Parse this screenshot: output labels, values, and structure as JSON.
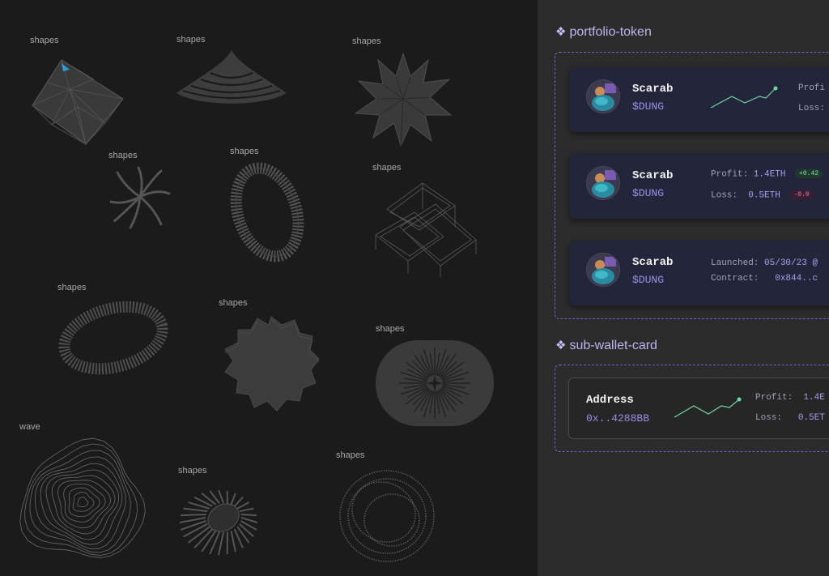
{
  "asset_panel": {
    "labels": [
      "shapes",
      "shapes",
      "shapes",
      "shapes",
      "shapes",
      "shapes",
      "shapes",
      "shapes",
      "shapes",
      "wave",
      "shapes",
      "shapes"
    ]
  },
  "colors": {
    "accent": "#7d5bd6",
    "spark": "#6fd6a0",
    "ticker": "#9a8fe8",
    "card_bg": "#23263a"
  },
  "components": {
    "portfolio_token": {
      "title": "portfolio-token",
      "icon": "component-diamond-icon",
      "cards": [
        {
          "name": "Scarab",
          "ticker": "$DUNG",
          "line1_label": "Profi",
          "line2_label": "Loss:"
        },
        {
          "name": "Scarab",
          "ticker": "$DUNG",
          "profit_label": "Profit:",
          "profit_value": "1.4ETH",
          "profit_pill": "+0.42",
          "loss_label": "Loss:",
          "loss_value": "0.5ETH",
          "loss_pill": "-0.0"
        },
        {
          "name": "Scarab",
          "ticker": "$DUNG",
          "launched_label": "Launched:",
          "launched_value": "05/30/23 @",
          "contract_label": "Contract:",
          "contract_value": "0x844..c"
        }
      ]
    },
    "sub_wallet_card": {
      "title": "sub-wallet-card",
      "icon": "component-diamond-icon",
      "address_label": "Address",
      "address_value": "0x..4288BB",
      "profit_label": "Profit:",
      "profit_value": "1.4E",
      "loss_label": "Loss:",
      "loss_value": "0.5ET"
    }
  }
}
